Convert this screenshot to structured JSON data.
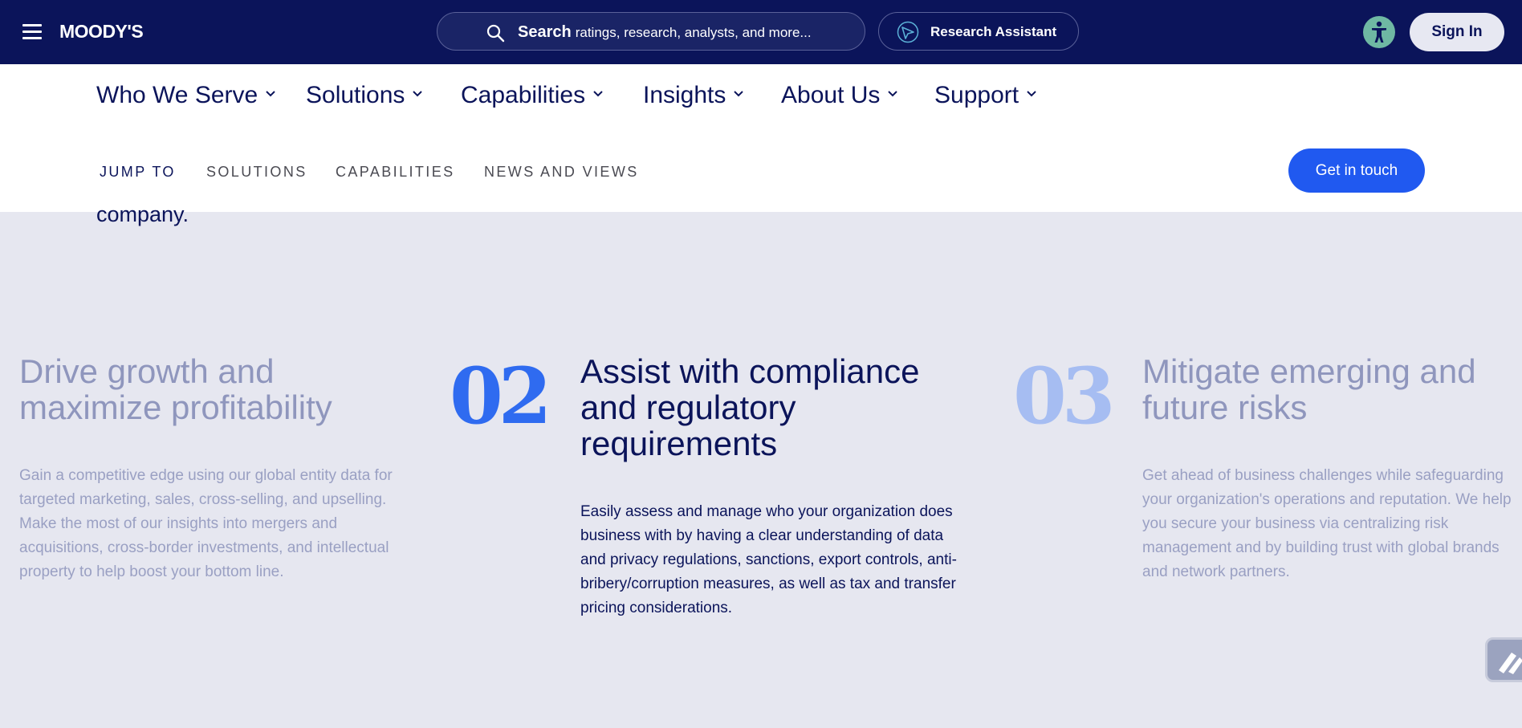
{
  "header": {
    "logo": "MOODY'S",
    "search": {
      "bold": "Search",
      "rest": "ratings, research, analysts, and more..."
    },
    "assistant_label": "Research Assistant",
    "signin_label": "Sign In"
  },
  "nav": {
    "items": [
      "Who We Serve",
      "Solutions",
      "Capabilities",
      "Insights",
      "About Us",
      "Support"
    ]
  },
  "jump": {
    "items": [
      "JUMP TO",
      "SOLUTIONS",
      "CAPABILITIES",
      "NEWS AND VIEWS"
    ],
    "cta": "Get in touch"
  },
  "content": {
    "cut_text": "company.",
    "col1": {
      "heading": "Drive growth and maximize profitability",
      "body": "Gain a competitive edge using our global entity data for targeted marketing, sales, cross-selling, and upselling. Make the most of our insights into mergers and acquisitions, cross-border investments, and intellectual property to help boost your bottom line."
    },
    "col2": {
      "number": "02",
      "heading": "Assist with compliance and regulatory requirements",
      "body": "Easily assess and manage who your organization does business with by having a clear understanding of data and privacy regulations, sanctions, export controls, anti-bribery/corruption measures, as well as tax and transfer pricing considerations."
    },
    "col3": {
      "number": "03",
      "heading": "Mitigate emerging and future risks",
      "body": "Get ahead of business challenges while safeguarding your organization's operations and reputation. We help you secure your business via centralizing risk management and by building trust with global brands and network partners."
    }
  },
  "colors": {
    "navy": "#0b145a",
    "accent": "#2059f0",
    "bg": "#e6e7f0"
  }
}
